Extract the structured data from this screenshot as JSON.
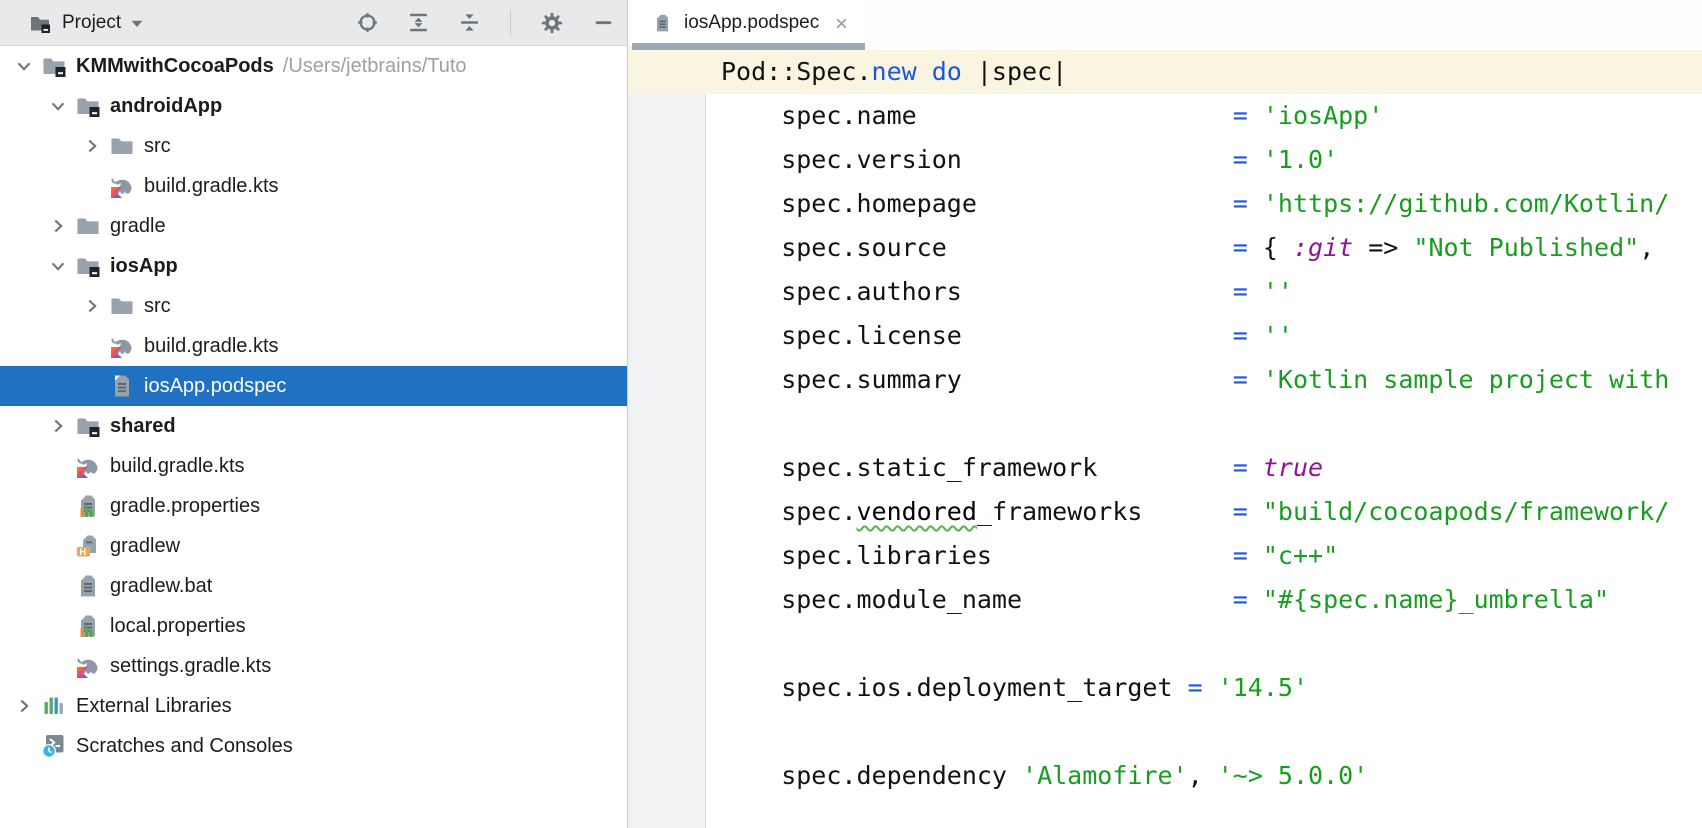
{
  "colors": {
    "selection_blue": "#2171C2",
    "string_green": "#1A9C21",
    "keyword_blue": "#1B55E3",
    "symbol_purple": "#8F1399",
    "caret_line_cream": "#FAF5E1",
    "tab_underline": "#9DA9B5",
    "toolbar_bg": "#E8E9EB",
    "gutter_bg": "#F1F2F3"
  },
  "project_panel": {
    "toolbar": {
      "title": "Project",
      "title_icon": "project-folder",
      "caret_icon": "caret-down",
      "icons": [
        "locate",
        "expand-all",
        "collapse-all",
        "separator",
        "settings-gear",
        "hide"
      ]
    },
    "tree": {
      "items": [
        {
          "label": "KMMwithCocoaPods",
          "suffix": "/Users/jetbrains/Tuto",
          "level": 0,
          "chevron": "down",
          "icon": "module-folder",
          "bold": true,
          "selected": false
        },
        {
          "label": "androidApp",
          "level": 1,
          "chevron": "down",
          "icon": "module-folder",
          "bold": true,
          "selected": false
        },
        {
          "label": "src",
          "level": 2,
          "chevron": "right",
          "icon": "folder",
          "bold": false,
          "selected": false
        },
        {
          "label": "build.gradle.kts",
          "level": 2,
          "chevron": "none",
          "icon": "gradle-kotlin",
          "bold": false,
          "selected": false
        },
        {
          "label": "gradle",
          "level": 1,
          "chevron": "right",
          "icon": "folder",
          "bold": false,
          "selected": false
        },
        {
          "label": "iosApp",
          "level": 1,
          "chevron": "down",
          "icon": "module-folder",
          "bold": true,
          "selected": false
        },
        {
          "label": "src",
          "level": 2,
          "chevron": "right",
          "icon": "folder",
          "bold": false,
          "selected": false
        },
        {
          "label": "build.gradle.kts",
          "level": 2,
          "chevron": "none",
          "icon": "gradle-kotlin",
          "bold": false,
          "selected": false
        },
        {
          "label": "iosApp.podspec",
          "level": 2,
          "chevron": "none",
          "icon": "document",
          "bold": false,
          "selected": true
        },
        {
          "label": "shared",
          "level": 1,
          "chevron": "right",
          "icon": "module-folder",
          "bold": true,
          "selected": false
        },
        {
          "label": "build.gradle.kts",
          "level": 1,
          "chevron": "none",
          "icon": "gradle-kotlin",
          "bold": false,
          "selected": false
        },
        {
          "label": "gradle.properties",
          "level": 1,
          "chevron": "none",
          "icon": "properties",
          "bold": false,
          "selected": false
        },
        {
          "label": "gradlew",
          "level": 1,
          "chevron": "none",
          "icon": "shell-script",
          "bold": false,
          "selected": false
        },
        {
          "label": "gradlew.bat",
          "level": 1,
          "chevron": "none",
          "icon": "document",
          "bold": false,
          "selected": false
        },
        {
          "label": "local.properties",
          "level": 1,
          "chevron": "none",
          "icon": "properties",
          "bold": false,
          "selected": false
        },
        {
          "label": "settings.gradle.kts",
          "level": 1,
          "chevron": "none",
          "icon": "gradle-kotlin",
          "bold": false,
          "selected": false
        },
        {
          "label": "External Libraries",
          "level": 0,
          "chevron": "right",
          "icon": "libraries",
          "bold": false,
          "selected": false
        },
        {
          "label": "Scratches and Consoles",
          "level": 0,
          "chevron": "none",
          "icon": "scratches",
          "bold": false,
          "selected": false
        }
      ]
    }
  },
  "editor": {
    "tab": {
      "label": "iosApp.podspec",
      "icon": "podspec-file",
      "close_icon": "close"
    },
    "lines": [
      {
        "segments": [
          {
            "t": "Pod::Spec.",
            "s": "pl"
          },
          {
            "t": "new do",
            "s": "kw"
          },
          {
            "t": " |spec|",
            "s": "pl"
          }
        ]
      },
      {
        "segments": [
          {
            "t": "    spec.name                     ",
            "s": "pl"
          },
          {
            "t": "= ",
            "s": "eq"
          },
          {
            "t": "'iosApp'",
            "s": "str"
          }
        ]
      },
      {
        "segments": [
          {
            "t": "    spec.version                  ",
            "s": "pl"
          },
          {
            "t": "= ",
            "s": "eq"
          },
          {
            "t": "'1.0'",
            "s": "str"
          }
        ]
      },
      {
        "segments": [
          {
            "t": "    spec.homepage                 ",
            "s": "pl"
          },
          {
            "t": "= ",
            "s": "eq"
          },
          {
            "t": "'https://github.com/Kotlin/",
            "s": "str"
          }
        ]
      },
      {
        "segments": [
          {
            "t": "    spec.source                   ",
            "s": "pl"
          },
          {
            "t": "= ",
            "s": "eq"
          },
          {
            "t": "{ ",
            "s": "pl"
          },
          {
            "t": ":git",
            "s": "sym"
          },
          {
            "t": " => ",
            "s": "pl"
          },
          {
            "t": "\"Not Published\"",
            "s": "str"
          },
          {
            "t": ",",
            "s": "pl"
          }
        ]
      },
      {
        "segments": [
          {
            "t": "    spec.authors                  ",
            "s": "pl"
          },
          {
            "t": "= ",
            "s": "eq"
          },
          {
            "t": "''",
            "s": "str"
          }
        ]
      },
      {
        "segments": [
          {
            "t": "    spec.license                  ",
            "s": "pl"
          },
          {
            "t": "= ",
            "s": "eq"
          },
          {
            "t": "''",
            "s": "str"
          }
        ]
      },
      {
        "segments": [
          {
            "t": "    spec.summary                  ",
            "s": "pl"
          },
          {
            "t": "= ",
            "s": "eq"
          },
          {
            "t": "'Kotlin sample project with",
            "s": "str"
          }
        ]
      },
      {
        "segments": []
      },
      {
        "segments": [
          {
            "t": "    spec.static_framework         ",
            "s": "pl"
          },
          {
            "t": "= ",
            "s": "eq"
          },
          {
            "t": "true",
            "s": "sym"
          }
        ]
      },
      {
        "segments": [
          {
            "t": "    spec.",
            "s": "pl"
          },
          {
            "t": "vendored",
            "s": "typo"
          },
          {
            "t": "_frameworks      ",
            "s": "pl"
          },
          {
            "t": "= ",
            "s": "eq"
          },
          {
            "t": "\"build/cocoapods/framework/",
            "s": "str"
          }
        ]
      },
      {
        "segments": [
          {
            "t": "    spec.libraries                ",
            "s": "pl"
          },
          {
            "t": "= ",
            "s": "eq"
          },
          {
            "t": "\"c++\"",
            "s": "str"
          }
        ]
      },
      {
        "segments": [
          {
            "t": "    spec.module_name              ",
            "s": "pl"
          },
          {
            "t": "= ",
            "s": "eq"
          },
          {
            "t": "\"#{spec.name}_umbrella\"",
            "s": "str"
          }
        ]
      },
      {
        "segments": []
      },
      {
        "segments": [
          {
            "t": "    spec.ios.deployment_target ",
            "s": "pl"
          },
          {
            "t": "= ",
            "s": "eq"
          },
          {
            "t": "'14.5'",
            "s": "str"
          }
        ]
      },
      {
        "segments": []
      },
      {
        "segments": [
          {
            "t": "    spec.dependency ",
            "s": "pl"
          },
          {
            "t": "'Alamofire'",
            "s": "str"
          },
          {
            "t": ", ",
            "s": "pl"
          },
          {
            "t": "'~> 5.0.0'",
            "s": "str"
          }
        ]
      }
    ]
  }
}
